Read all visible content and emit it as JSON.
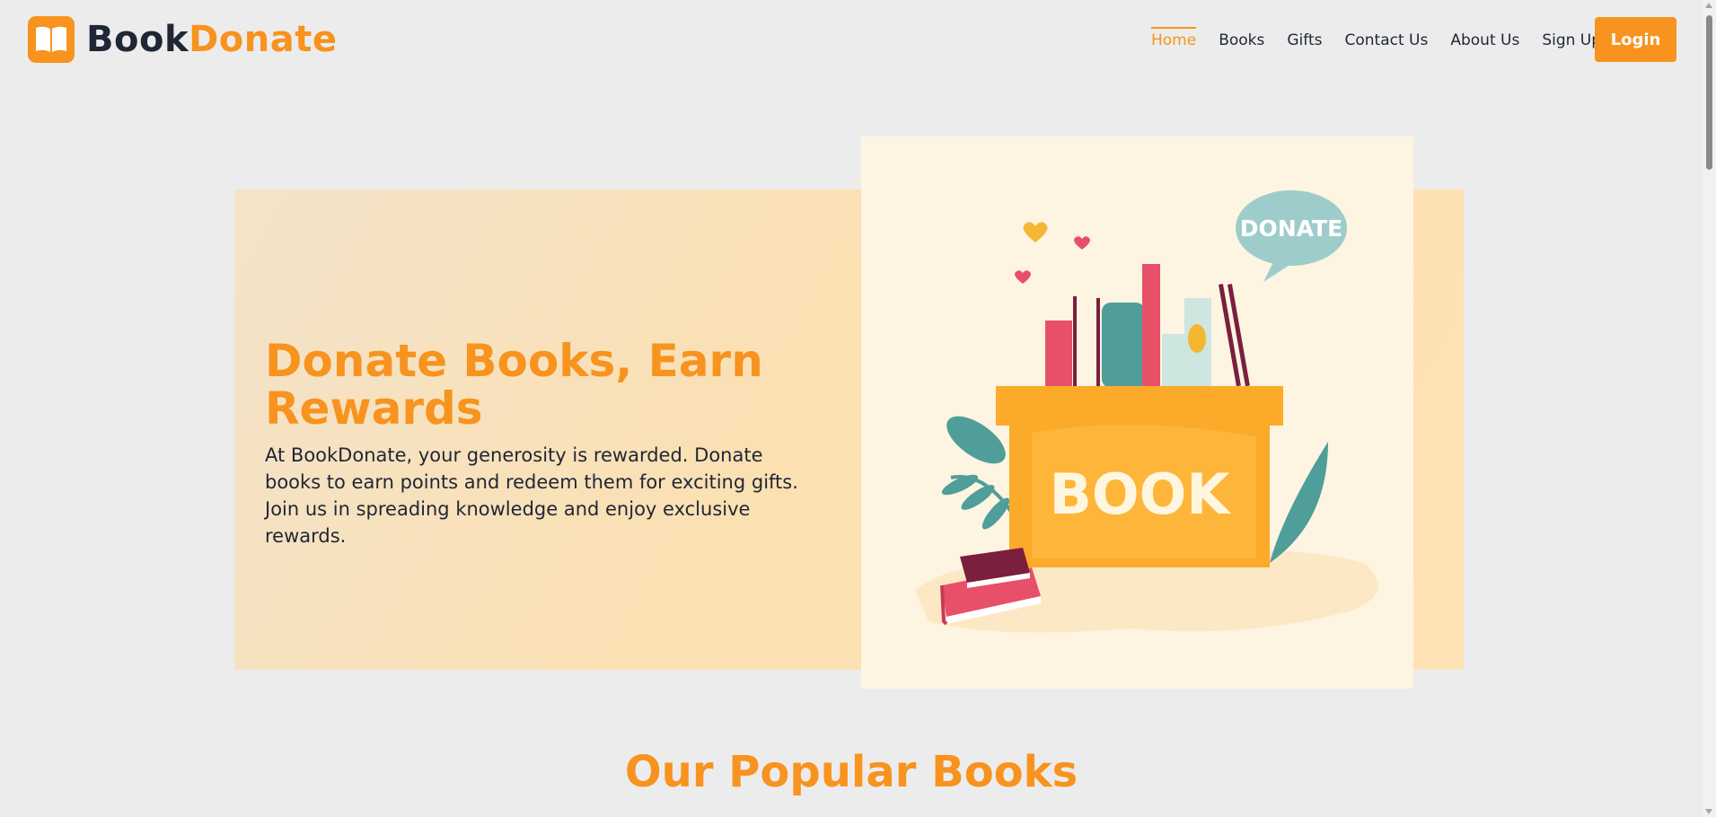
{
  "brand": {
    "part1": "Book",
    "part2": "Donate",
    "accent": "#f7931e",
    "dark": "#1f2636"
  },
  "nav": {
    "items": [
      {
        "label": "Home",
        "active": true
      },
      {
        "label": "Books"
      },
      {
        "label": "Gifts"
      },
      {
        "label": "Contact Us"
      },
      {
        "label": "About Us"
      },
      {
        "label": "Sign Up"
      }
    ],
    "login_label": "Login"
  },
  "hero": {
    "title": "Donate Books, Earn Rewards",
    "description": "At BookDonate, your generosity is rewarded. Donate books to earn points and redeem them for exciting gifts. Join us in spreading knowledge and enjoy exclusive rewards.",
    "image": {
      "speech_bubble": "DONATE",
      "box_label": "BOOK"
    }
  },
  "popular": {
    "title": "Our Popular Books"
  },
  "icons": [
    "open-book-icon",
    "heart-icon",
    "scroll-up-arrow-icon",
    "scroll-down-arrow-icon"
  ]
}
